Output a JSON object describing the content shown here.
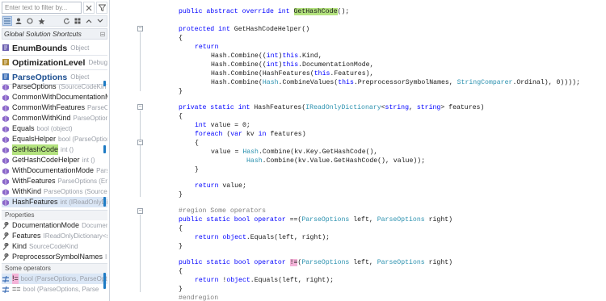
{
  "panel": {
    "filter_placeholder": "Enter text to filter by...",
    "header_title": "Global Solution Shortcuts",
    "groups": [
      {
        "name": "EnumBounds",
        "type": "Object"
      },
      {
        "name": "OptimizationLevel",
        "type": "Debug"
      },
      {
        "name": "ParseOptions",
        "type": "Object"
      }
    ],
    "members": [
      {
        "name": "ParseOptions",
        "type": "(SourceCodeKin"
      },
      {
        "name": "CommonWithDocumentationM",
        "type": ""
      },
      {
        "name": "CommonWithFeatures",
        "type": "ParseOpti"
      },
      {
        "name": "CommonWithKind",
        "type": "ParseOptions"
      },
      {
        "name": "Equals",
        "type": "bool (object)"
      },
      {
        "name": "EqualsHelper",
        "type": "bool (ParseOptions)"
      },
      {
        "name": "GetHashCode",
        "type": "int ()"
      },
      {
        "name": "GetHashCodeHelper",
        "type": "int ()"
      },
      {
        "name": "WithDocumentationMode",
        "type": "Parse"
      },
      {
        "name": "WithFeatures",
        "type": "ParseOptions (Enum"
      },
      {
        "name": "WithKind",
        "type": "ParseOptions (SourceCo"
      },
      {
        "name": "HashFeatures",
        "type": "int (IReadOnlyDict"
      }
    ],
    "properties_label": "Properties",
    "properties": [
      {
        "name": "DocumentationMode",
        "type": "Documen"
      },
      {
        "name": "Features",
        "type": "IReadOnlyDictionary<str"
      },
      {
        "name": "Kind",
        "type": "SourceCodeKind"
      },
      {
        "name": "PreprocessorSymbolNames",
        "type": "IE"
      }
    ],
    "operators_label": "Some operators",
    "operators": [
      {
        "name": "!=",
        "type": "bool (ParseOptions, ParseOptio"
      },
      {
        "name": "==",
        "type": "bool (ParseOptions, Parse"
      }
    ]
  },
  "code": {
    "line1": {
      "kw": "public abstract override int ",
      "fn": "GetHashCode",
      "rest": "();"
    },
    "line2": {
      "kw1": "protected int",
      "rest": " GetHashCodeHelper()"
    },
    "open1": "{",
    "ret1": "return",
    "h1": "Hash.Combine((",
    "h1kw": "int",
    "h1b": ")",
    "h1this": "this",
    "h1c": ".Kind,",
    "h2": "Hash.Combine((",
    "h2c": ".DocumentationMode,",
    "h3": "Hash.Combine(HashFeatures(",
    "h3c": ".Features),",
    "h4": "Hash.Combine(",
    "h4b": "Hash",
    "h4c": ".CombineValues(",
    "h4d": ".PreprocessorSymbolNames, ",
    "h4type": "StringComparer",
    "h4e": ".Ordinal), 0))));",
    "close1": "}",
    "m3": {
      "kw": "private static int",
      "name": " HashFeatures(",
      "type": "IReadOnlyDictionary",
      "lt": "<",
      "s1": "string",
      "comma": ", ",
      "s2": "string",
      "gt": "> features)"
    },
    "open2": "{",
    "v1kw": "int",
    "v1": " value = 0;",
    "fe": "foreach",
    "fe2": " (",
    "fe3": "var",
    "fe4": " kv ",
    "fe5": "in",
    "fe6": " features)",
    "open3": "{",
    "v2a": "value = ",
    "v2b": "Hash",
    "v2c": ".Combine(kv.Key.GetHashCode(),",
    "v3b": "Hash",
    "v3c": ".Combine(kv.Value.GetHashCode(), value));",
    "close3": "}",
    "ret2": "return",
    "ret2b": " value;",
    "close2": "}",
    "region": "#region Some operators",
    "op1kw": "public static bool operator",
    "op1op": " ==(",
    "op1t": "ParseOptions",
    "op1b": " left, ",
    "op1t2": "ParseOptions",
    "op1c": " right)",
    "open4": "{",
    "r3kw": "return",
    "r3obj": " object",
    "r3b": ".Equals(left, right);",
    "close4": "}",
    "op2kw": "public static bool operator",
    "op2op": "!=",
    "op2a": "(",
    "op2t": "ParseOptions",
    "op2b": " left, ",
    "op2t2": "ParseOptions",
    "op2c": " right)",
    "open5": "{",
    "r4kw": "return",
    "r4b": " !",
    "r4obj": "object",
    "r4c": ".Equals(left, right);",
    "close5": "}",
    "endregion": "#endregion"
  },
  "colors": {
    "keyword": "#0000ff",
    "type": "#2b91af",
    "highlight": "#b3e27e",
    "operator_highlight": "#f4b3d8",
    "scroll_marker": "#1e7bc4"
  }
}
